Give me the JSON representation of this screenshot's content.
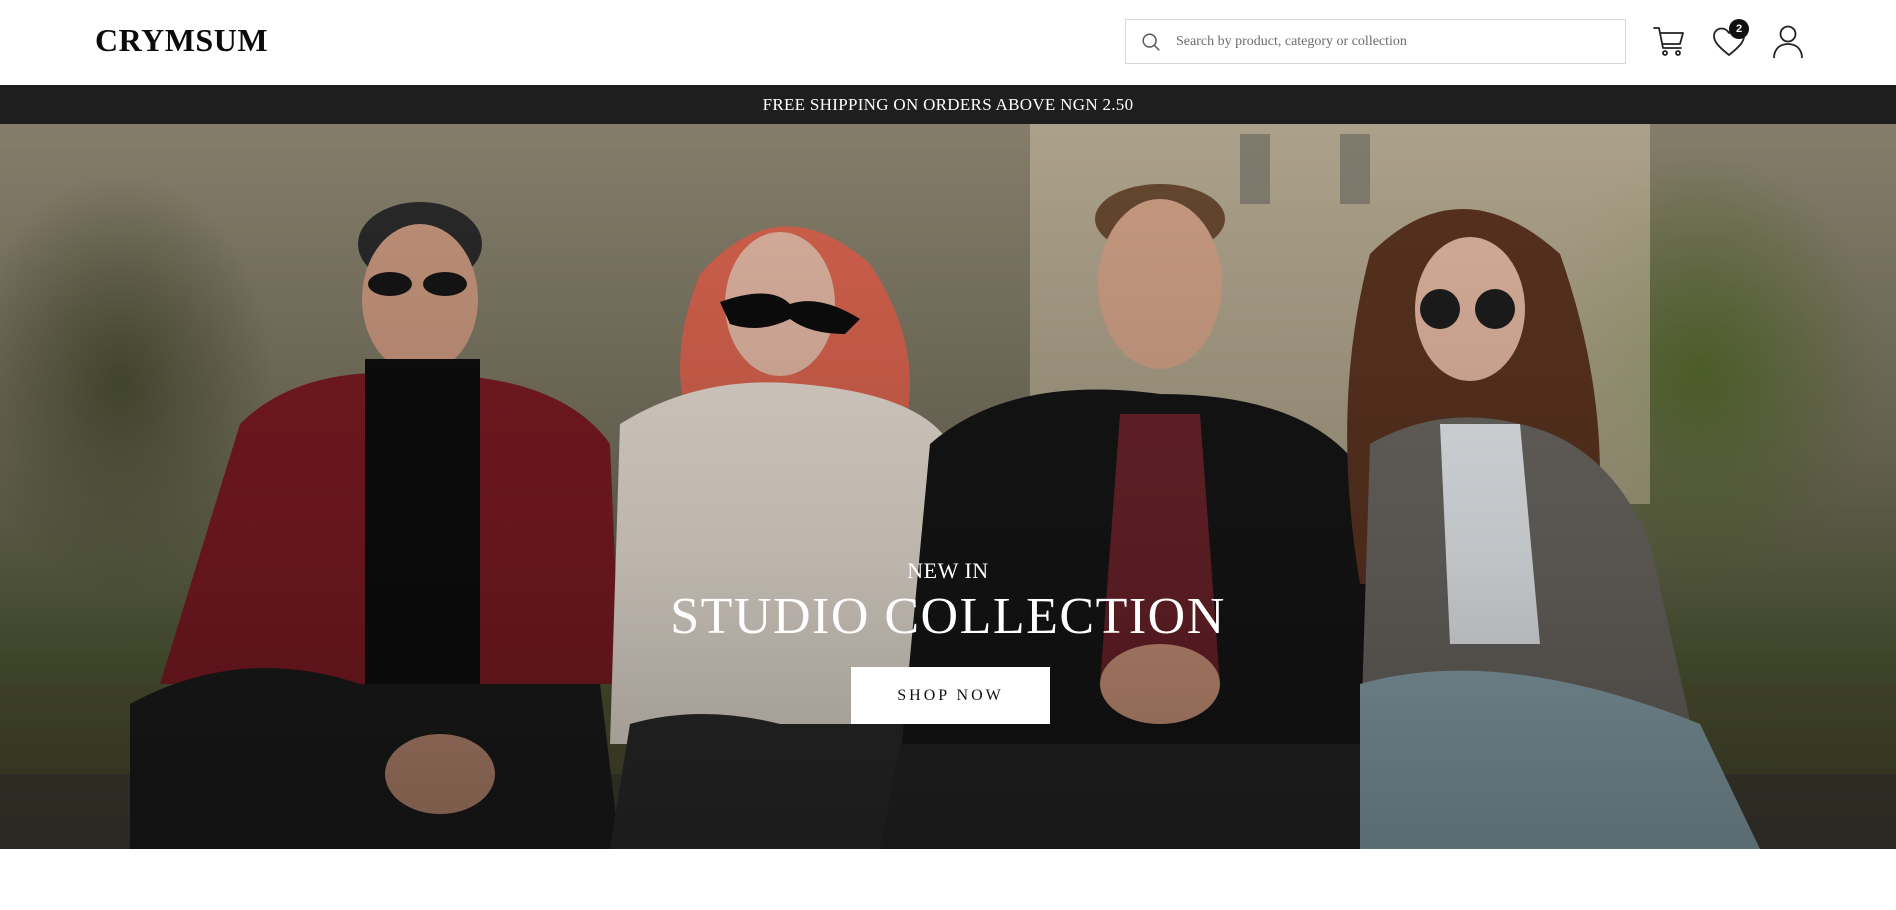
{
  "header": {
    "logo": "CRYMSUM",
    "search": {
      "placeholder": "Search by product, category or collection",
      "value": ""
    },
    "icons": [
      "search-icon",
      "cart-icon",
      "heart-icon",
      "user-icon"
    ],
    "wishlist_count": "2"
  },
  "promo_bar": {
    "text": "FREE SHIPPING ON ORDERS ABOVE NGN 2.50"
  },
  "hero": {
    "kicker": "NEW IN",
    "headline": "STUDIO COLLECTION",
    "cta_label": "SHOP NOW"
  },
  "colors": {
    "promo_bg": "#1e1e1e",
    "text_dark": "#111111",
    "cta_bg": "#ffffff"
  }
}
